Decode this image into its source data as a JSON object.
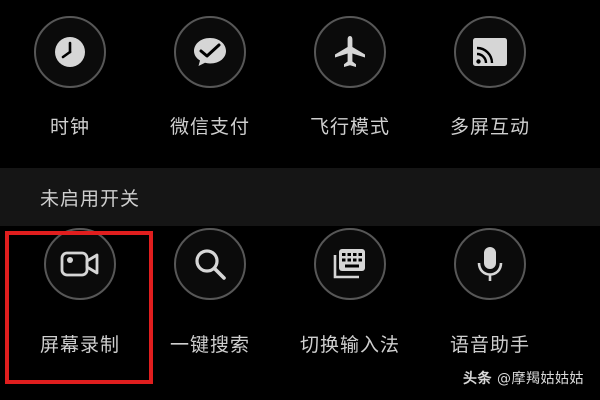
{
  "enabled_toggles": [
    {
      "label": "时钟",
      "icon": "clock-icon"
    },
    {
      "label": "微信支付",
      "icon": "wechat-pay-icon"
    },
    {
      "label": "飞行模式",
      "icon": "airplane-icon"
    },
    {
      "label": "多屏互动",
      "icon": "cast-icon"
    }
  ],
  "disabled_section": {
    "title": "未启用开关",
    "toggles": [
      {
        "label": "屏幕录制",
        "icon": "screen-record-icon"
      },
      {
        "label": "一键搜索",
        "icon": "search-icon"
      },
      {
        "label": "切换输入法",
        "icon": "keyboard-icon"
      },
      {
        "label": "语音助手",
        "icon": "microphone-icon"
      }
    ]
  },
  "highlight_color": "#e01e1e",
  "watermark": {
    "logo": "头条",
    "handle": "@摩羯姑姑姑"
  }
}
